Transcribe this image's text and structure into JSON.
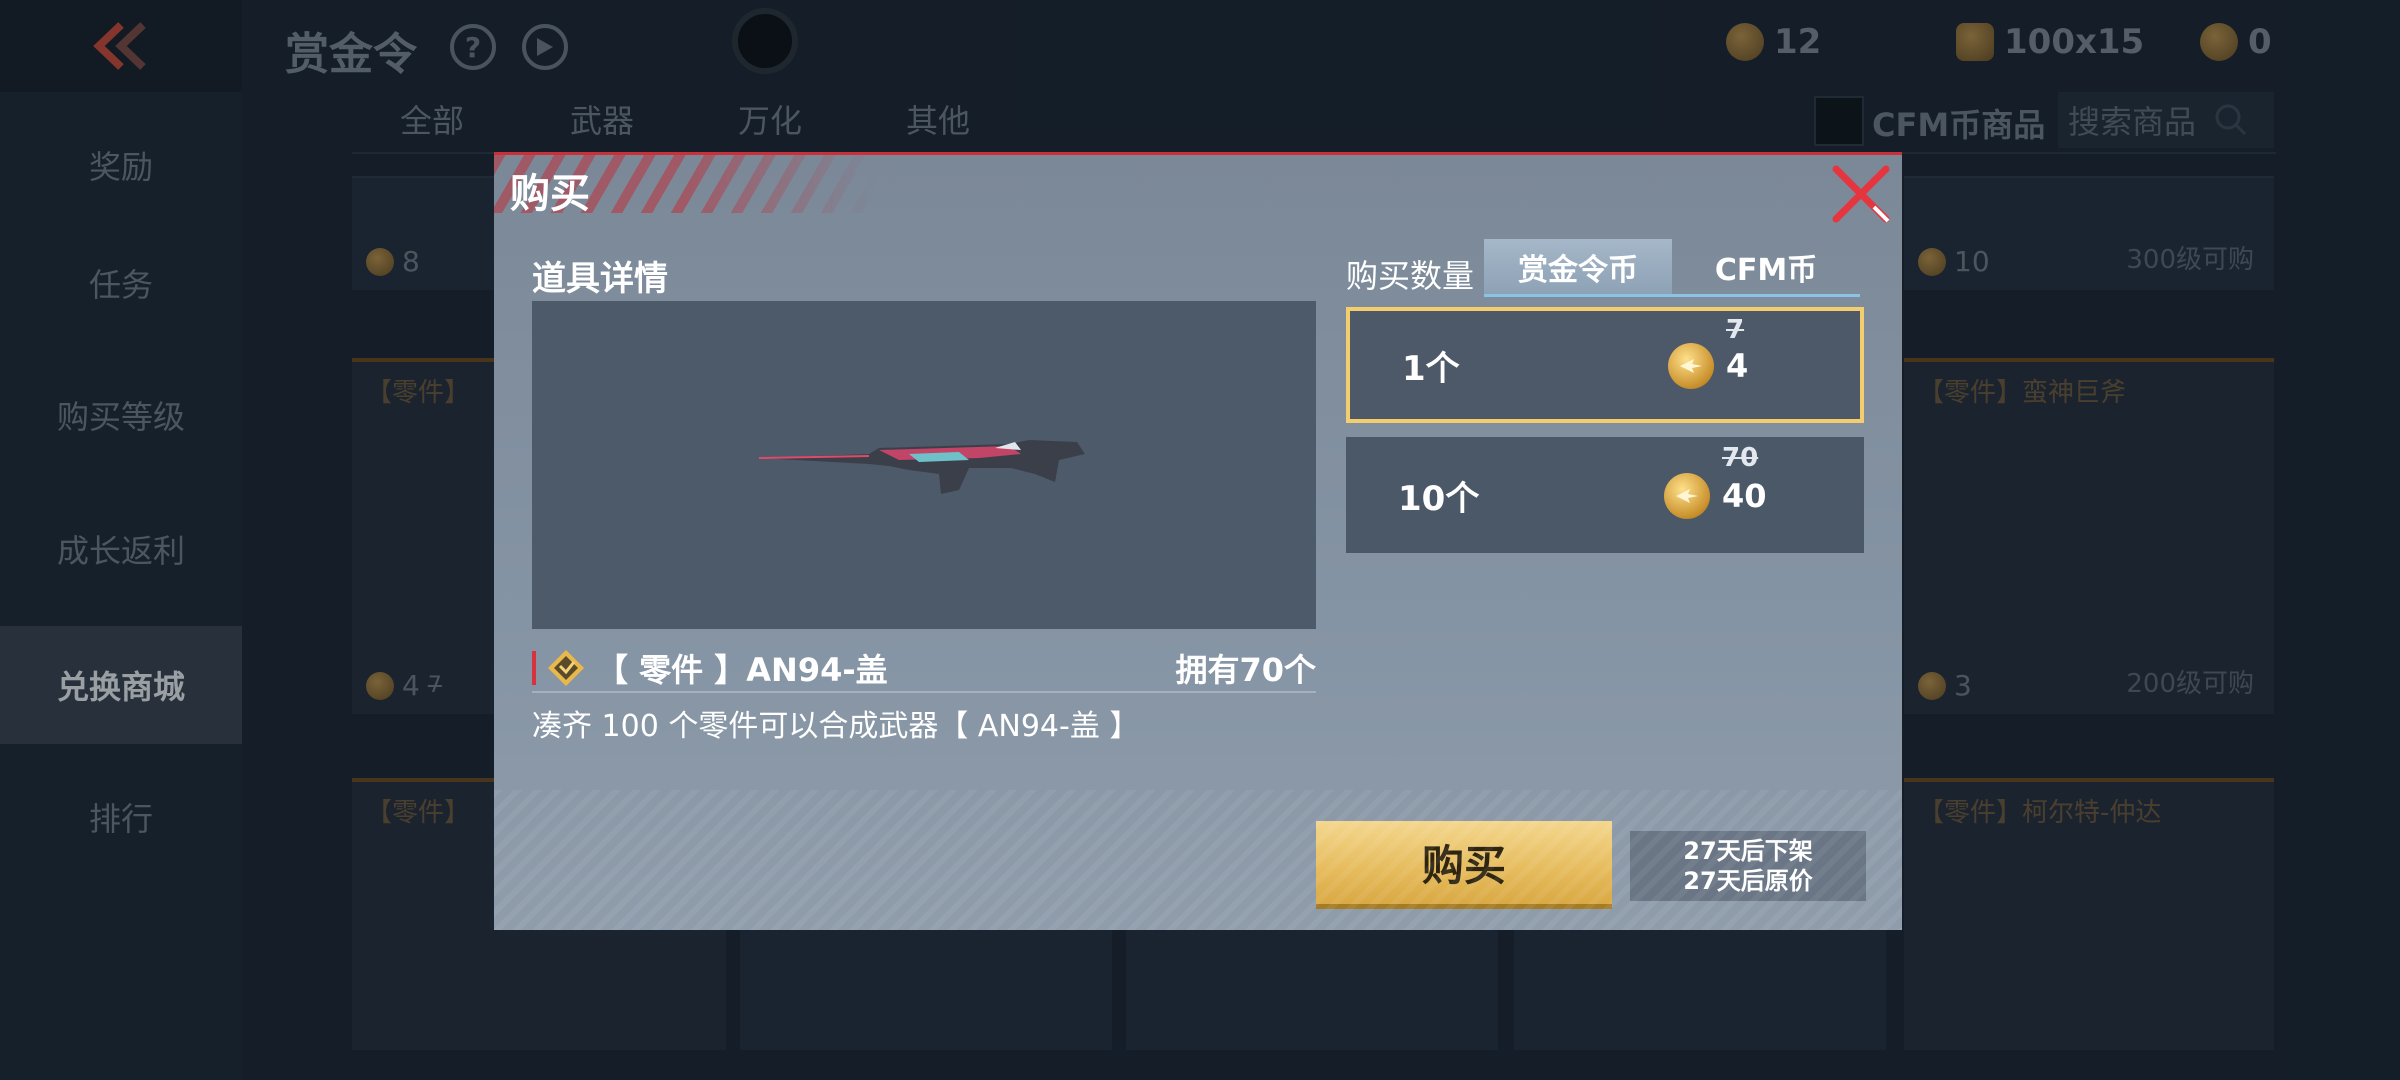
{
  "header": {
    "title": "赏金令",
    "currencies": [
      {
        "icon": "bounty-coin-icon",
        "value": "12"
      },
      {
        "icon": "medal-icon",
        "value": "100x15"
      },
      {
        "icon": "gold-coin-icon",
        "value": "0"
      }
    ]
  },
  "sidebar": {
    "items": [
      {
        "label": "奖励"
      },
      {
        "label": "任务"
      },
      {
        "label": "购买等级"
      },
      {
        "label": "成长返利"
      },
      {
        "label": "兑换商城",
        "active": true
      },
      {
        "label": "排行"
      }
    ]
  },
  "categories": [
    "全部",
    "武器",
    "万化",
    "其他"
  ],
  "shop": {
    "cfm_filter_label": "CFM币商品",
    "search_placeholder": "搜索商品",
    "cards": [
      {
        "price": "8"
      },
      {
        "price": "10",
        "level": "300级可购"
      },
      {
        "label": "【零件】",
        "price": "4",
        "old_price": "7"
      },
      {
        "label": "【零件】蛮神巨斧",
        "price": "3",
        "level": "200级可购"
      },
      {
        "label": "【零件】"
      },
      {
        "label": "【零件】柯尔特-仲达"
      }
    ]
  },
  "modal": {
    "title": "购买",
    "section_title": "道具详情",
    "item_name": "【 零件 】AN94-盖",
    "owned": "拥有70个",
    "description": "凑齐 100 个零件可以合成武器【 AN94-盖 】",
    "qty_label": "购买数量",
    "pay_tabs": [
      {
        "label": "赏金令币",
        "active": true
      },
      {
        "label": "CFM币",
        "active": false
      }
    ],
    "options": [
      {
        "qty": "1个",
        "old_price": "7",
        "price": "4",
        "selected": true
      },
      {
        "qty": "10个",
        "old_price": "70",
        "price": "40",
        "selected": false
      }
    ],
    "buy_label": "购买",
    "timer_line1": "27天后下架",
    "timer_line2": "27天后原价"
  },
  "colors": {
    "accent_gold": "#f3ce6e",
    "close_red": "#d8323c",
    "tab_underline": "#8bc3e6"
  }
}
